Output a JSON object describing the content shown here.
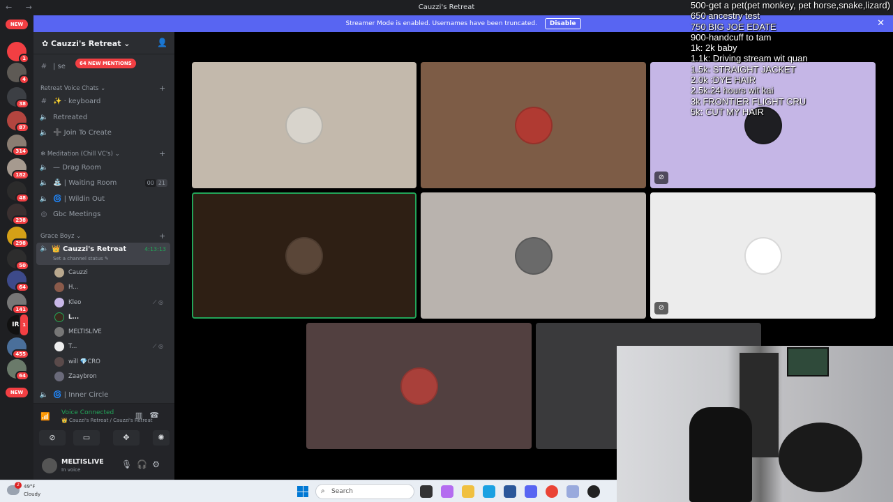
{
  "titlebar": {
    "title": "Cauzzi's Retreat",
    "nav": "← →"
  },
  "banner": {
    "text": "Streamer Mode is enabled. Usernames have been truncated.",
    "button": "Disable",
    "close": "✕"
  },
  "server_rail": {
    "new_top": "NEW",
    "new_bottom": "NEW",
    "badges": [
      "3",
      "1",
      "4",
      "38",
      "87",
      "314",
      "182",
      "48",
      "238",
      "298",
      "50",
      "64",
      "141",
      "1",
      "455",
      "64"
    ],
    "iri_label": "IRI"
  },
  "guild": {
    "name": "Cauzzi's Retreat",
    "mentions": "64 NEW MENTIONS",
    "top_channel": "| se"
  },
  "categories": {
    "retreat_voice": "Retreat Voice Chats",
    "meditation": "Meditation (Chill VC's)",
    "grace_boyz": "Grace Boyz"
  },
  "channels": {
    "keyboard": "· keyboard",
    "retreated": "Retreated",
    "join_to_create": "Join To Create",
    "drag_room": "Drag Room",
    "waiting_room": "| Waiting Room",
    "waiting_counts": [
      "00",
      "21"
    ],
    "wildin_out": "| Wildin Out",
    "gbc_meetings": "Gbc Meetings",
    "inner_circle": "| Inner Circle"
  },
  "active_channel": {
    "name": "Cauzzi's Retreat",
    "timer": "4:13:13",
    "status": "Set a channel status ✎"
  },
  "members": [
    {
      "name": "Cauzzi",
      "flags": ""
    },
    {
      "name": "H...",
      "flags": ""
    },
    {
      "name": "Kleo",
      "flags": "⟋ ◎"
    },
    {
      "name": "L...",
      "flags": ""
    },
    {
      "name": "MELTISLIVE",
      "flags": ""
    },
    {
      "name": "T...",
      "flags": "⟋ ◎"
    },
    {
      "name": "will 💎CRO",
      "flags": ""
    },
    {
      "name": "Zaaybron",
      "flags": ""
    }
  ],
  "voice_panel": {
    "status": "Voice Connected",
    "location": "👑 Cauzzi's Retreat / Cauzzi's Retreat",
    "username": "MELTISLIVE",
    "user_status": "In voice"
  },
  "overlay_lines": [
    "500-get a pet(pet monkey, pet horse,snake,lizard)",
    "650 ancestry test",
    "750 BIG JOE EDATE",
    "900-handcuff to tam",
    "1k: 2k baby",
    "1.1k: Driving stream wit quan",
    "1.5k: STRAIGHT JACKET",
    "2.0k :DYE HAIR",
    "2.5k:24 hours wit kai",
    "3k FRONTIER FLIGHT CRU",
    "5k: CUT MY HAIR"
  ],
  "taskbar": {
    "temp": "49°F",
    "condition": "Cloudy",
    "notif": "2",
    "search_placeholder": "Search"
  },
  "colors": {
    "blurple": "#5865f2",
    "green": "#23a559",
    "red": "#f23f43",
    "sidebar": "#2b2d31",
    "rail": "#1e1f22"
  }
}
